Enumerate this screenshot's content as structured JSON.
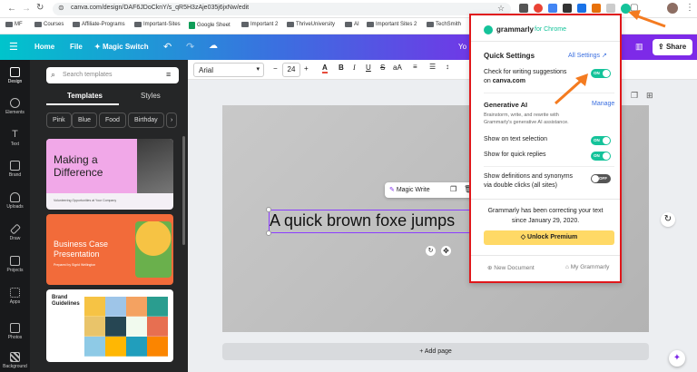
{
  "browser": {
    "url": "canva.com/design/DAF6JDoCknY/s_qR5H3zAje035j6jxNw/edit",
    "bookmarks": [
      {
        "label": "MF",
        "type": "folder"
      },
      {
        "label": "Courses",
        "type": "folder"
      },
      {
        "label": "Affiliate-Programs",
        "type": "folder"
      },
      {
        "label": "Important-Sites",
        "type": "folder"
      },
      {
        "label": "Google Sheet",
        "type": "sheet"
      },
      {
        "label": "Important 2",
        "type": "folder"
      },
      {
        "label": "ThriveUniversity",
        "type": "folder"
      },
      {
        "label": "AI",
        "type": "folder"
      },
      {
        "label": "Important Sites 2",
        "type": "folder"
      },
      {
        "label": "TechSmith",
        "type": "folder"
      }
    ]
  },
  "header": {
    "home": "Home",
    "file": "File",
    "magic_switch": "Magic Switch",
    "partial_title": "Yo",
    "share": "Share"
  },
  "rail": [
    {
      "label": "Design",
      "icon": "design-icon"
    },
    {
      "label": "Elements",
      "icon": "elements-icon"
    },
    {
      "label": "Text",
      "icon": "text-icon"
    },
    {
      "label": "Brand",
      "icon": "brand-icon"
    },
    {
      "label": "Uploads",
      "icon": "uploads-icon"
    },
    {
      "label": "Draw",
      "icon": "draw-icon"
    },
    {
      "label": "Projects",
      "icon": "projects-icon"
    },
    {
      "label": "Apps",
      "icon": "apps-icon"
    },
    {
      "label": "Photos",
      "icon": "photos-icon"
    },
    {
      "label": "Background",
      "icon": "background-icon"
    }
  ],
  "panel": {
    "search_placeholder": "Search templates",
    "tab_templates": "Templates",
    "tab_styles": "Styles",
    "chips": [
      "Pink",
      "Blue",
      "Food",
      "Birthday"
    ],
    "templates": [
      {
        "title": "Making a Difference",
        "subtitle": "Volunteering Opportunities at Your Company"
      },
      {
        "title": "Business Case Presentation",
        "subtitle": "Prepared by Sigrid Wellington"
      },
      {
        "title": "Brand Guidelines",
        "subtitle": ""
      }
    ]
  },
  "toolbar": {
    "font": "Arial",
    "size": "24",
    "minus": "−",
    "plus": "+"
  },
  "canvas": {
    "text": "A quick brown foxe jumps",
    "magic_write": "Magic Write",
    "add_page": "+ Add page"
  },
  "grammarly": {
    "brand": "grammarly",
    "for": "for Chrome",
    "quick_settings": "Quick Settings",
    "all_settings": "All Settings",
    "check_line1": "Check for writing suggestions",
    "check_line2_prefix": "on ",
    "check_domain": "canva.com",
    "gen_ai": "Generative AI",
    "manage": "Manage",
    "gen_desc1": "Brainstorm, write, and rewrite with",
    "gen_desc2": "Grammarly's generative AI assistance.",
    "show_selection": "Show on text selection",
    "show_quick": "Show for quick replies",
    "show_defs1": "Show definitions and synonyms",
    "show_defs2": "via double clicks (all sites)",
    "correcting1": "Grammarly has been correcting your text",
    "correcting2": "since January 29, 2020.",
    "unlock": "Unlock Premium",
    "new_doc": "New Document",
    "my_grammarly": "My Grammarly",
    "toggle_on": "ON",
    "toggle_off": "OFF"
  },
  "colors": {
    "accent": "#15c39a",
    "highlight_border": "#e0171b",
    "arrow": "#f47b20",
    "canva_purple": "#7d2ae8",
    "premium": "#ffd966"
  }
}
